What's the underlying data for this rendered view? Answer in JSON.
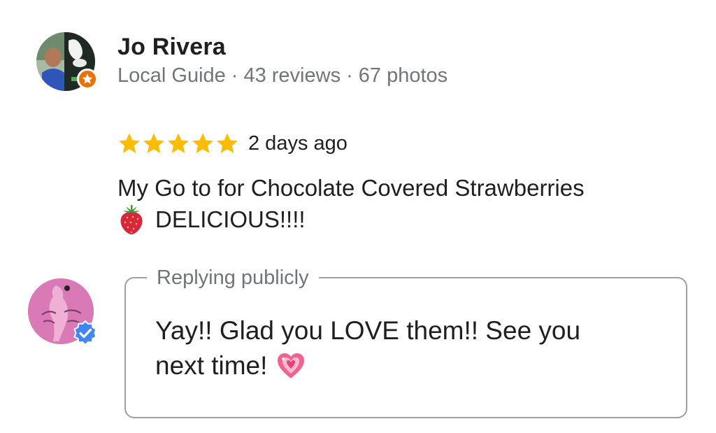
{
  "reviewer": {
    "name": "Jo Rivera",
    "badge_icon": "local-guide-star-icon",
    "meta": {
      "level": "Local Guide",
      "separator": "·",
      "reviews": "43 reviews",
      "photos": "67 photos"
    }
  },
  "review": {
    "rating": 5,
    "max_rating": 5,
    "star_color": "#fbbc04",
    "date": "2 days ago",
    "text_line1": "My Go to for Chocolate Covered Strawberries",
    "emoji_icon": "strawberry-icon",
    "text_line2": "DELICIOUS!!!!"
  },
  "owner_reply": {
    "label": "Replying publicly",
    "verified_icon": "verified-check-icon",
    "verified_color": "#4285f4",
    "text_line1": "Yay!! Glad you LOVE them!! See you",
    "text_line2": "next time!",
    "emoji_icon": "sparkling-heart-icon"
  }
}
